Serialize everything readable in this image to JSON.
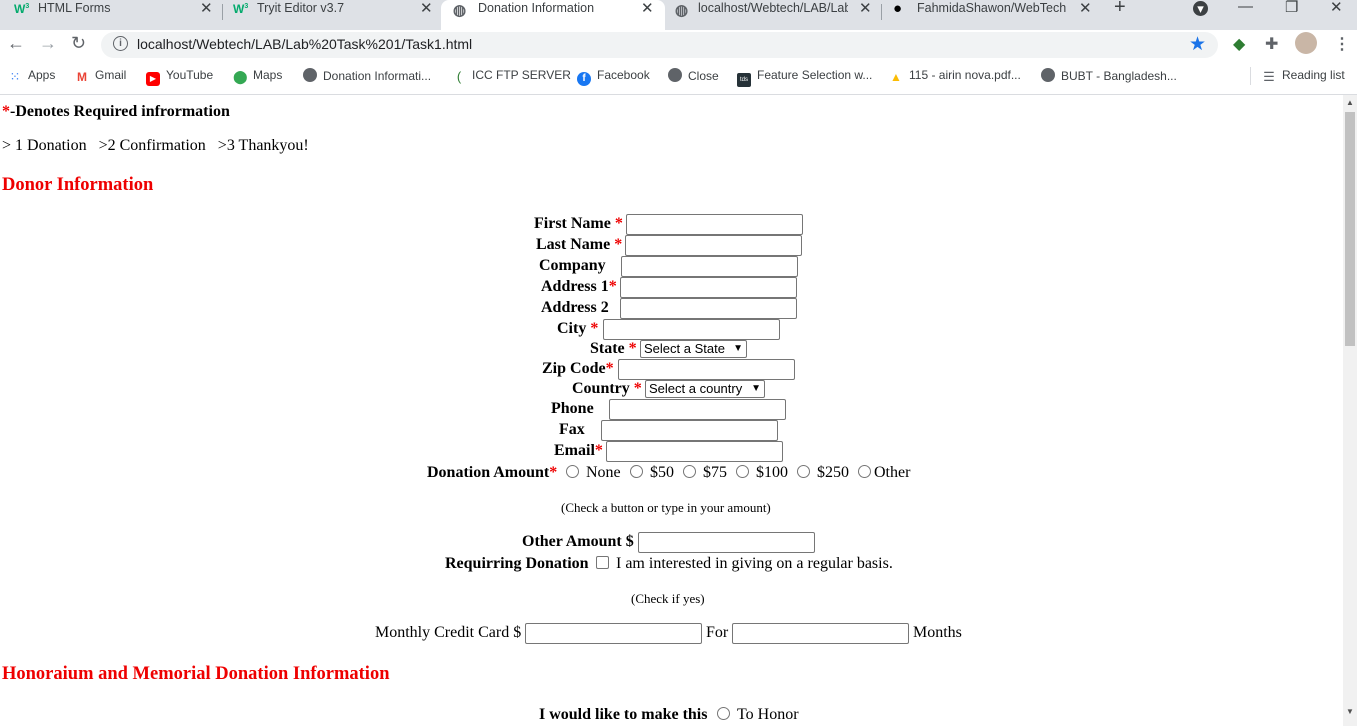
{
  "browser": {
    "tabs": [
      {
        "title": "HTML Forms",
        "icon": "W",
        "icon_color": "#04aa6d"
      },
      {
        "title": "Tryit Editor v3.7",
        "icon": "W",
        "icon_color": "#04aa6d"
      },
      {
        "title": "Donation Information",
        "icon": "globe",
        "active": true
      },
      {
        "title": "localhost/Webtech/LAB/Lab",
        "icon": "globe"
      },
      {
        "title": "FahmidaShawon/WebTech",
        "icon": "github"
      }
    ],
    "new_tab": "+",
    "url": "localhost/Webtech/LAB/Lab%20Task%201/Task1.html",
    "bookmarks": [
      {
        "label": "Apps",
        "icon": "apps-grid-icon"
      },
      {
        "label": "Gmail",
        "icon": "gmail-icon"
      },
      {
        "label": "YouTube",
        "icon": "youtube-icon"
      },
      {
        "label": "Maps",
        "icon": "maps-icon"
      },
      {
        "label": "Donation Informati...",
        "icon": "globe-icon"
      },
      {
        "label": "ICC FTP SERVER",
        "icon": "icc-icon"
      },
      {
        "label": "Facebook",
        "icon": "facebook-icon"
      },
      {
        "label": "Close",
        "icon": "globe-icon"
      },
      {
        "label": "Feature Selection w...",
        "icon": "tds-icon"
      },
      {
        "label": "115 - airin nova.pdf...",
        "icon": "drive-icon"
      },
      {
        "label": "BUBT - Bangladesh...",
        "icon": "globe-icon"
      }
    ],
    "reading_list": "Reading list"
  },
  "page": {
    "required_note_star": "*",
    "required_note": "-Denotes Required infrormation",
    "steps": "> 1 Donation   >2 Confirmation   >3 Thankyou!",
    "donor_heading": "Donor Information",
    "fields": {
      "first_name": "First Name",
      "last_name": "Last Name",
      "company": "Company",
      "address1": "Address 1",
      "address2": "Address 2",
      "city": "City",
      "state": "State",
      "state_select": "Select a State",
      "zip": "Zip Code",
      "country": "Country",
      "country_select": "Select a country",
      "phone": "Phone",
      "fax": "Fax",
      "email": "Email"
    },
    "star": "*",
    "donation_amount_label": "Donation Amount",
    "amount_options": [
      "None",
      "$50",
      "$75",
      "$100",
      "$250",
      "Other"
    ],
    "amount_hint": "(Check a button or type in your amount)",
    "other_amount_label": "Other Amount $",
    "recurring_label": "Requirring Donation",
    "recurring_text": "I am interested in giving on a regular basis.",
    "recurring_hint": "(Check if yes)",
    "monthly_label": "Monthly Credit Card $",
    "for_label": "For",
    "months_label": "Months",
    "honor_heading": "Honoraium and Memorial Donation Information",
    "make_this_label": "I would like to make this",
    "to_honor": "To Honor"
  }
}
